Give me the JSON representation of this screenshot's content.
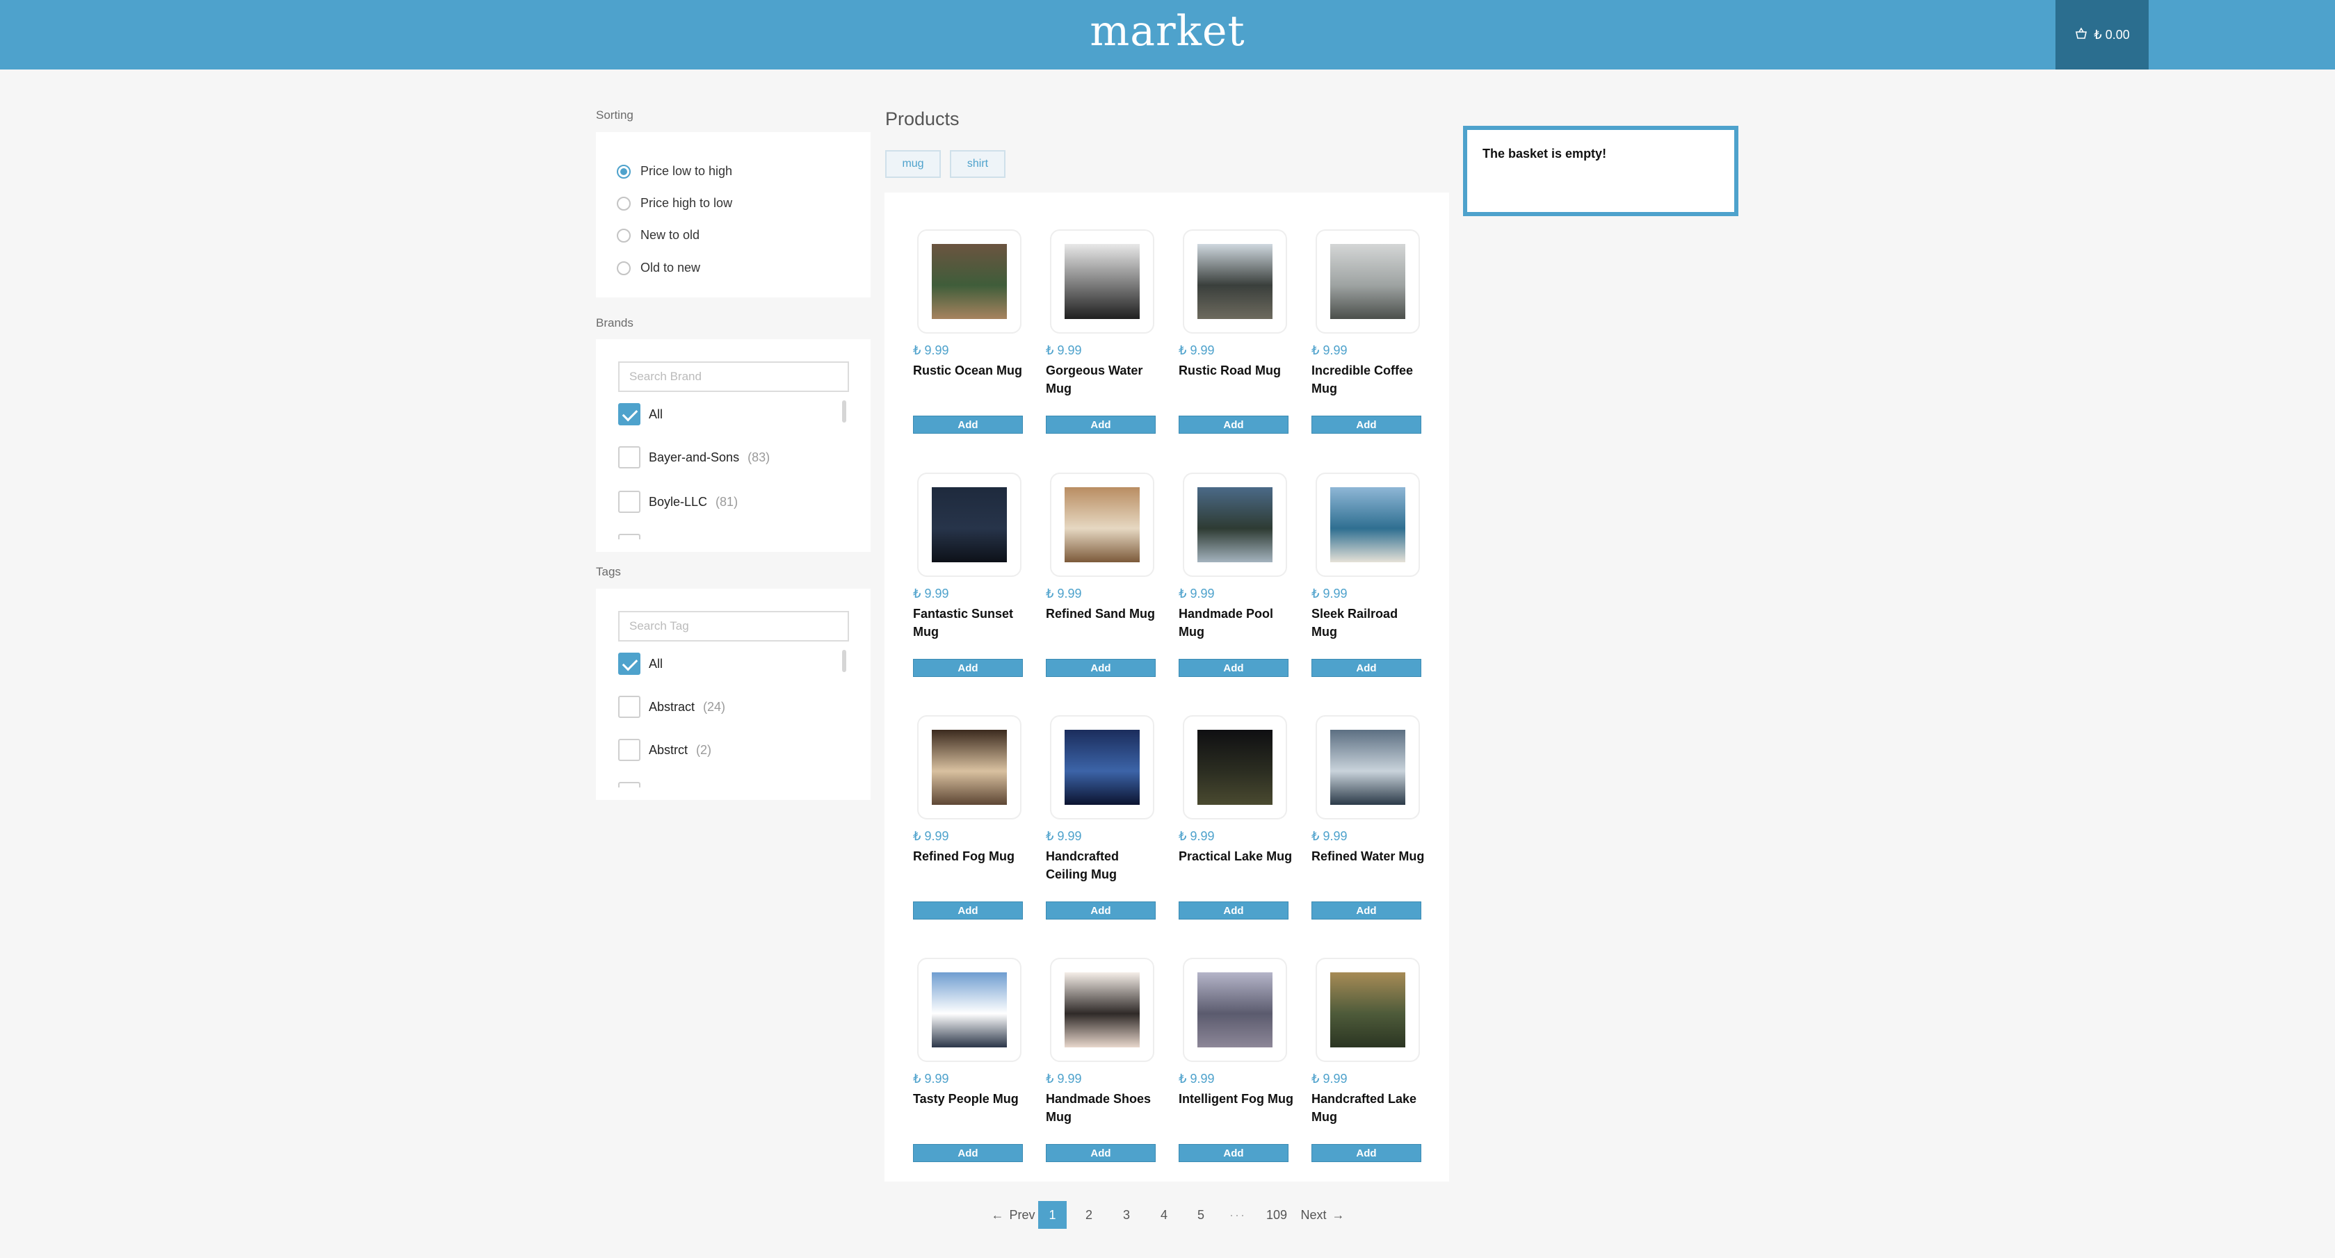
{
  "header": {
    "logo": "market",
    "cart_total": "₺ 0.00"
  },
  "sidebar": {
    "sorting_title": "Sorting",
    "sort_options": [
      "Price low to high",
      "Price high to low",
      "New to old",
      "Old to new"
    ],
    "sort_selected": "Price low to high",
    "brands_title": "Brands",
    "brand_search_placeholder": "Search Brand",
    "brands": [
      {
        "label": "All",
        "count": "",
        "checked": true
      },
      {
        "label": "Bayer-and-Sons",
        "count": "(83)",
        "checked": false
      },
      {
        "label": "Boyle-LLC",
        "count": "(81)",
        "checked": false
      }
    ],
    "tags_title": "Tags",
    "tag_search_placeholder": "Search Tag",
    "tags": [
      {
        "label": "All",
        "count": "",
        "checked": true
      },
      {
        "label": "Abstract",
        "count": "(24)",
        "checked": false
      },
      {
        "label": "Abstrct",
        "count": "(2)",
        "checked": false
      }
    ]
  },
  "main": {
    "title": "Products",
    "type_chips": [
      "mug",
      "shirt"
    ],
    "add_label": "Add",
    "products": [
      {
        "price": "₺ 9.99",
        "name": "Rustic Ocean Mug",
        "image": "wooden-shed-photo"
      },
      {
        "price": "₺ 9.99",
        "name": "Gorgeous Water Mug",
        "image": "cloudy-sky-photo"
      },
      {
        "price": "₺ 9.99",
        "name": "Rustic Road Mug",
        "image": "legs-on-rocks-photo"
      },
      {
        "price": "₺ 9.99",
        "name": "Incredible Coffee Mug",
        "image": "foggy-hill-photo"
      },
      {
        "price": "₺ 9.99",
        "name": "Fantastic Sunset Mug",
        "image": "night-sky-photo"
      },
      {
        "price": "₺ 9.99",
        "name": "Refined Sand Mug",
        "image": "wooden-floor-photo"
      },
      {
        "price": "₺ 9.99",
        "name": "Handmade Pool Mug",
        "image": "mountain-valley-photo"
      },
      {
        "price": "₺ 9.99",
        "name": "Sleek Railroad Mug",
        "image": "coastline-photo"
      },
      {
        "price": "₺ 9.99",
        "name": "Refined Fog Mug",
        "image": "hand-light-photo"
      },
      {
        "price": "₺ 9.99",
        "name": "Handcrafted Ceiling Mug",
        "image": "milky-way-photo"
      },
      {
        "price": "₺ 9.99",
        "name": "Practical Lake Mug",
        "image": "dark-landscape-photo"
      },
      {
        "price": "₺ 9.99",
        "name": "Refined Water Mug",
        "image": "ocean-waves-photo"
      },
      {
        "price": "₺ 9.99",
        "name": "Tasty People Mug",
        "image": "snowy-mountain-photo"
      },
      {
        "price": "₺ 9.99",
        "name": "Handmade Shoes Mug",
        "image": "palm-trees-photo"
      },
      {
        "price": "₺ 9.99",
        "name": "Intelligent Fog Mug",
        "image": "misty-peaks-photo"
      },
      {
        "price": "₺ 9.99",
        "name": "Handcrafted Lake Mug",
        "image": "green-hills-photo"
      }
    ]
  },
  "pagination": {
    "prev": "Prev",
    "pages": [
      "1",
      "2",
      "3",
      "4",
      "5"
    ],
    "current": "1",
    "ellipsis": "···",
    "last": "109",
    "next": "Next"
  },
  "basket": {
    "empty_text": "The basket is empty!"
  },
  "colors": {
    "accent": "#4ea2cc",
    "cart_dark": "#2b6e8f"
  }
}
